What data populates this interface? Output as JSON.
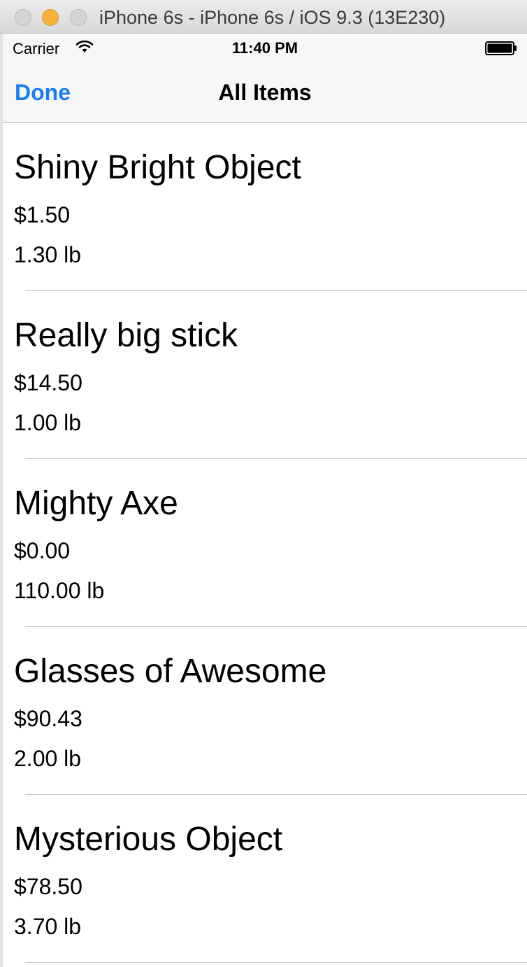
{
  "window": {
    "title": "iPhone 6s - iPhone 6s / iOS 9.3 (13E230)"
  },
  "status_bar": {
    "carrier": "Carrier",
    "time": "11:40 PM",
    "wifi_icon": "wifi-icon",
    "battery_icon": "battery-icon"
  },
  "nav_bar": {
    "done_label": "Done",
    "title": "All Items"
  },
  "colors": {
    "accent": "#1a7ef2",
    "separator": "#c8c7cc",
    "bar_background": "#f7f7f7"
  },
  "items": [
    {
      "name": "Shiny Bright Object",
      "price": "$1.50",
      "weight": "1.30 lb"
    },
    {
      "name": "Really big stick",
      "price": "$14.50",
      "weight": "1.00 lb"
    },
    {
      "name": "Mighty Axe",
      "price": "$0.00",
      "weight": "110.00 lb"
    },
    {
      "name": "Glasses of Awesome",
      "price": "$90.43",
      "weight": "2.00 lb"
    },
    {
      "name": "Mysterious Object",
      "price": "$78.50",
      "weight": "3.70 lb"
    }
  ]
}
